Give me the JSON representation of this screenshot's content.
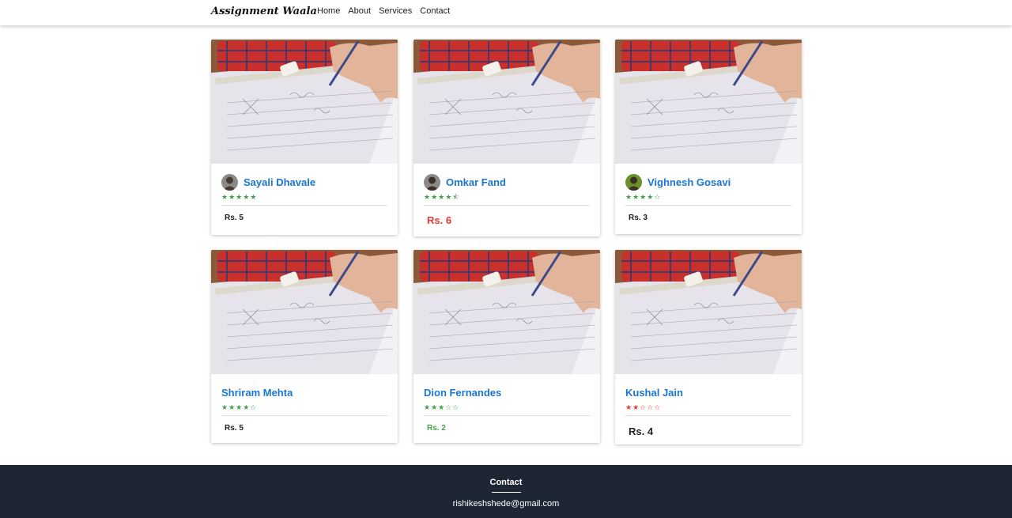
{
  "navbar": {
    "brand": "Assignment Waala",
    "links": [
      "Home",
      "About",
      "Services",
      "Contact"
    ]
  },
  "cards": [
    {
      "name": "Sayali Dhavale",
      "stars": "★★★★★",
      "star_color": "#43a047",
      "price": "Rs. 5",
      "price_style": "normal",
      "avatar": "female-avatar"
    },
    {
      "name": "Omkar Fand",
      "stars": "★★★★⯪",
      "star_color": "#43a047",
      "price": "Rs. 6",
      "price_style": "red",
      "avatar": "male-avatar"
    },
    {
      "name": "Vighnesh Gosavi",
      "stars": "★★★★☆",
      "star_color": "#43a047",
      "price": "Rs. 3",
      "price_style": "normal",
      "avatar": "male-avatar-green"
    },
    {
      "name": "Shriram Mehta",
      "stars": "★★★★☆",
      "star_color": "#43a047",
      "price": "Rs. 5",
      "price_style": "normal",
      "avatar": null
    },
    {
      "name": "Dion Fernandes",
      "stars": "★★★☆☆",
      "star_color": "#43a047",
      "price": "Rs. 2",
      "price_style": "green",
      "avatar": null
    },
    {
      "name": "Kushal Jain",
      "stars": "★★☆☆☆",
      "star_color": "#e53935",
      "price": "Rs. 4",
      "price_style": "big",
      "avatar": null
    }
  ],
  "footer": {
    "title": "Contact",
    "email": "rishikeshshede@gmail.com"
  }
}
